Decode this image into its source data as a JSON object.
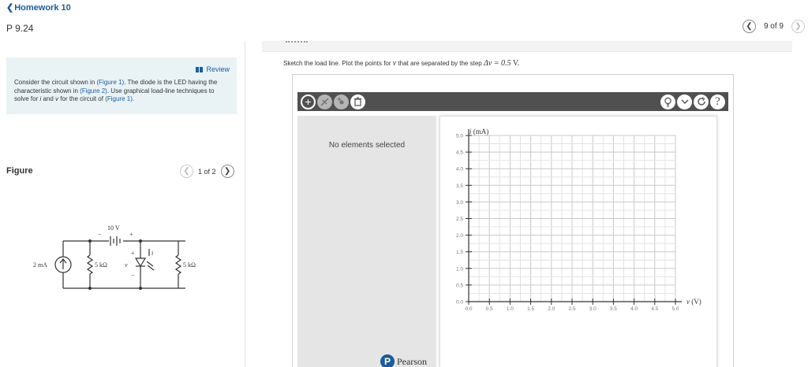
{
  "nav": {
    "back_label": "Homework 10",
    "problem_title": "P 9.24"
  },
  "pager": {
    "label": "9 of 9",
    "prev_icon": "chevron-left-icon",
    "next_icon": "chevron-right-icon"
  },
  "review": {
    "link_label": "Review",
    "text_parts": [
      "Consider the circuit shown in ",
      "(Figure 1)",
      ". The diode is the LED having the characteristic shown in ",
      "(Figure 2)",
      ". Use graphical load-line techniques to solve for ",
      "i",
      " and ",
      "v",
      " for the circuit of ",
      "(Figure 1)",
      "."
    ]
  },
  "figure": {
    "label": "Figure",
    "pager_label": "1 of 2"
  },
  "circuit": {
    "source_label": "2 mA",
    "battery_label": "10 V",
    "battery_minus": "−",
    "battery_plus": "+",
    "r1_label": "5 kΩ",
    "r2_label": "5 kΩ",
    "diode_v": "v",
    "diode_plus": "+",
    "diode_minus": "−",
    "diode_i": "i"
  },
  "instruction": {
    "before": "Sketch the load line. Plot the points for ",
    "var": "v",
    "middle": " that are separated by the step ",
    "step_expr": "Δv = 0.5",
    "unit": " V."
  },
  "toolbar": {
    "left_icons": [
      "plus-icon",
      "no-edit-icon",
      "add-point-icon",
      "trash-icon"
    ],
    "right_icons": [
      "lightbulb-icon",
      "chevron-down-icon",
      "reset-icon",
      "help-icon"
    ],
    "help_glyph": "?"
  },
  "selection": {
    "empty_text": "No elements selected"
  },
  "chart_data": {
    "type": "scatter",
    "ylabel_var": "i",
    "ylabel_unit": " (mA)",
    "xlabel_var": "v",
    "xlabel_unit": " (V)",
    "xlim": [
      0,
      5.0
    ],
    "ylim": [
      0,
      5.0
    ],
    "xticks": [
      "0.0",
      "0.5",
      "1.0",
      "1.5",
      "2.0",
      "2.5",
      "3.0",
      "3.5",
      "4.0",
      "4.5",
      "5.0"
    ],
    "yticks": [
      "0.0",
      "0.5",
      "1.0",
      "1.5",
      "2.0",
      "2.5",
      "3.0",
      "3.5",
      "4.0",
      "4.5",
      "5.0"
    ],
    "grid": true,
    "series": []
  },
  "footer": {
    "brand": "Pearson",
    "logo_letter": "P"
  }
}
